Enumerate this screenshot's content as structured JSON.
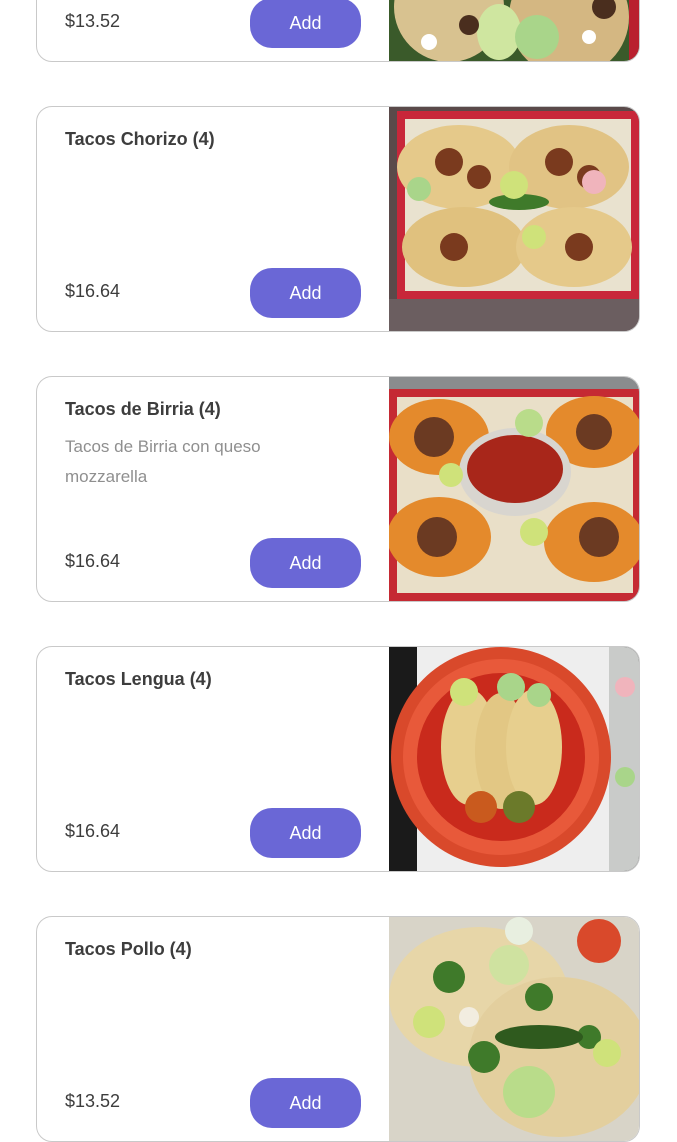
{
  "menu_items": [
    {
      "name": "",
      "description": "",
      "price": "$13.52",
      "button_label": "Add",
      "image_icon": "food-photo"
    },
    {
      "name": "Tacos Chorizo (4)",
      "description": "",
      "price": "$16.64",
      "button_label": "Add",
      "image_icon": "food-photo"
    },
    {
      "name": "Tacos de Birria (4)",
      "description": "Tacos de Birria con queso mozzarella",
      "price": "$16.64",
      "button_label": "Add",
      "image_icon": "food-photo"
    },
    {
      "name": "Tacos Lengua (4)",
      "description": "",
      "price": "$16.64",
      "button_label": "Add",
      "image_icon": "food-photo"
    },
    {
      "name": "Tacos Pollo (4)",
      "description": "",
      "price": "$13.52",
      "button_label": "Add",
      "image_icon": "food-photo"
    }
  ],
  "colors": {
    "accent": "#6a67d6",
    "border": "#c9c9c9",
    "text": "#3d3d3d",
    "muted": "#8f8f8f"
  }
}
